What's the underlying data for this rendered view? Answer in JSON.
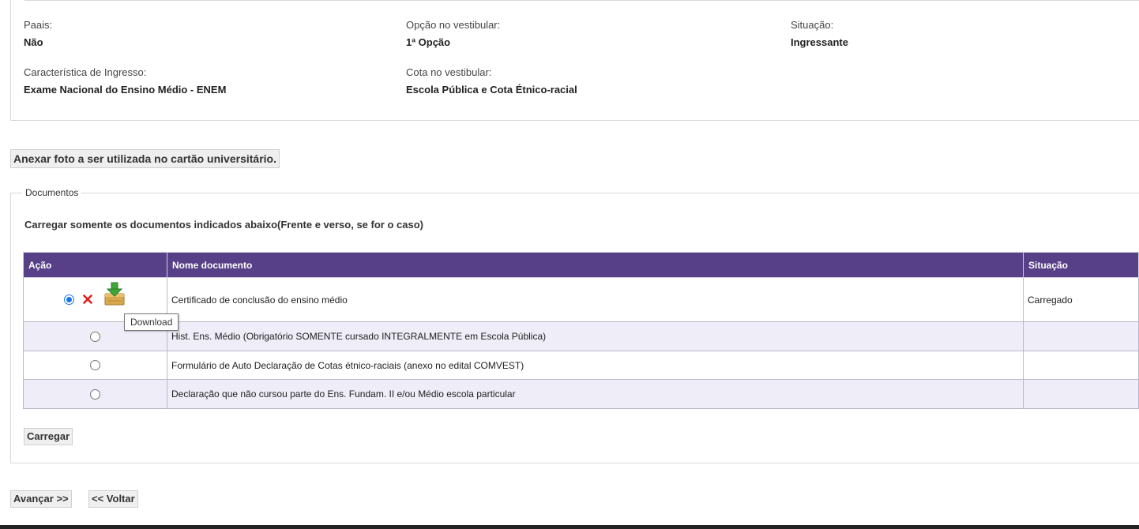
{
  "info": {
    "paais": {
      "label": "Paais:",
      "value": "Não"
    },
    "opcao": {
      "label": "Opção no vestibular:",
      "value": "1ª Opção"
    },
    "situacao": {
      "label": "Situação:",
      "value": "Ingressante"
    },
    "caracteristica": {
      "label": "Característica de Ingresso:",
      "value": "Exame Nacional do Ensino Médio - ENEM"
    },
    "cota": {
      "label": "Cota no vestibular:",
      "value": "Escola Pública e Cota Étnico-racial"
    }
  },
  "photo_button": "Anexar foto a ser utilizada no cartão universitário.",
  "documents": {
    "legend": "Documentos",
    "instruction": "Carregar somente os documentos indicados abaixo(Frente e verso, se for o caso)",
    "columns": [
      "Ação",
      "Nome documento",
      "Situação"
    ],
    "rows": [
      {
        "name": "Certificado de conclusão do ensino médio",
        "status": "Carregado",
        "selected": true
      },
      {
        "name": "Hist. Ens. Médio (Obrigatório SOMENTE cursado INTEGRALMENTE em Escola Pública)",
        "status": "",
        "selected": false
      },
      {
        "name": "Formulário de Auto Declaração de Cotas étnico-raciais (anexo no edital COMVEST)",
        "status": "",
        "selected": false
      },
      {
        "name": "Declaração que não cursou parte do Ens. Fundam. II e/ou Médio escola particular",
        "status": "",
        "selected": false
      }
    ],
    "upload_button": "Carregar",
    "tooltip": "Download"
  },
  "nav": {
    "next": "Avançar >>",
    "back": "<< Voltar"
  },
  "colors": {
    "header_bg": "#574088",
    "alt_row_bg": "#eeedf8",
    "delete_red": "#e02020",
    "radio_blue": "#1a73e8"
  }
}
